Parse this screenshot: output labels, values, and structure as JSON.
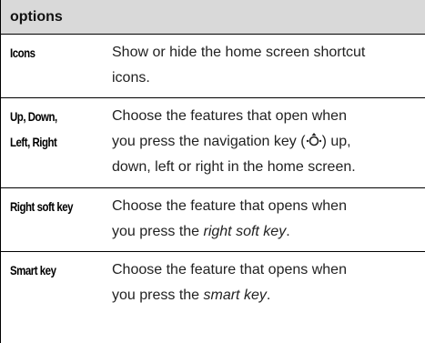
{
  "table": {
    "header": "options",
    "rows": [
      {
        "term_lines": [
          "Icons"
        ],
        "desc_lines": [
          "Show or hide the home screen shortcut",
          "icons."
        ]
      },
      {
        "term_lines": [
          "Up, Down,",
          "Left, Right"
        ],
        "desc_lines": [
          "Choose the features that open when",
          "you press the navigation key (",
          ") up,",
          "down, left or right in the home screen."
        ],
        "nav_icon": "navigation-key-icon"
      },
      {
        "term_lines": [
          "Right soft key"
        ],
        "desc_lines": [
          "Choose the feature that opens when",
          "you press the ",
          "right soft key",
          "."
        ]
      },
      {
        "term_lines": [
          "Smart key"
        ],
        "desc_lines": [
          "Choose the feature that opens when",
          "you press the ",
          "smart key",
          "."
        ]
      }
    ]
  }
}
